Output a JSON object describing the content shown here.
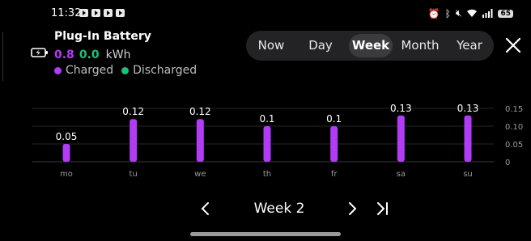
{
  "status_bar": {
    "time": "11:32",
    "battery": "65"
  },
  "header": {
    "title": "Plug-In Battery",
    "charged_value": "0.8",
    "discharged_value": "0.0",
    "unit": "kWh",
    "legend_charged": "Charged",
    "legend_discharged": "Discharged",
    "charged_color": "#b23cf5",
    "discharged_color": "#1ec07a"
  },
  "period_tabs": [
    {
      "label": "Now",
      "active": false
    },
    {
      "label": "Day",
      "active": false
    },
    {
      "label": "Week",
      "active": true
    },
    {
      "label": "Month",
      "active": false
    },
    {
      "label": "Year",
      "active": false
    }
  ],
  "week_nav": {
    "label": "Week 2"
  },
  "chart_data": {
    "type": "bar",
    "categories": [
      "mo",
      "tu",
      "we",
      "th",
      "fr",
      "sa",
      "su"
    ],
    "values": [
      0.05,
      0.12,
      0.12,
      0.1,
      0.1,
      0.13,
      0.13
    ],
    "value_labels": [
      "0.05",
      "0.12",
      "0.12",
      "0.1",
      "0.1",
      "0.13",
      "0.13"
    ],
    "y_ticks": [
      "0.15",
      "0.10",
      "0.05",
      "0"
    ],
    "ylim": [
      0,
      0.15
    ],
    "grid": true,
    "bar_color": "#b23cf5"
  }
}
